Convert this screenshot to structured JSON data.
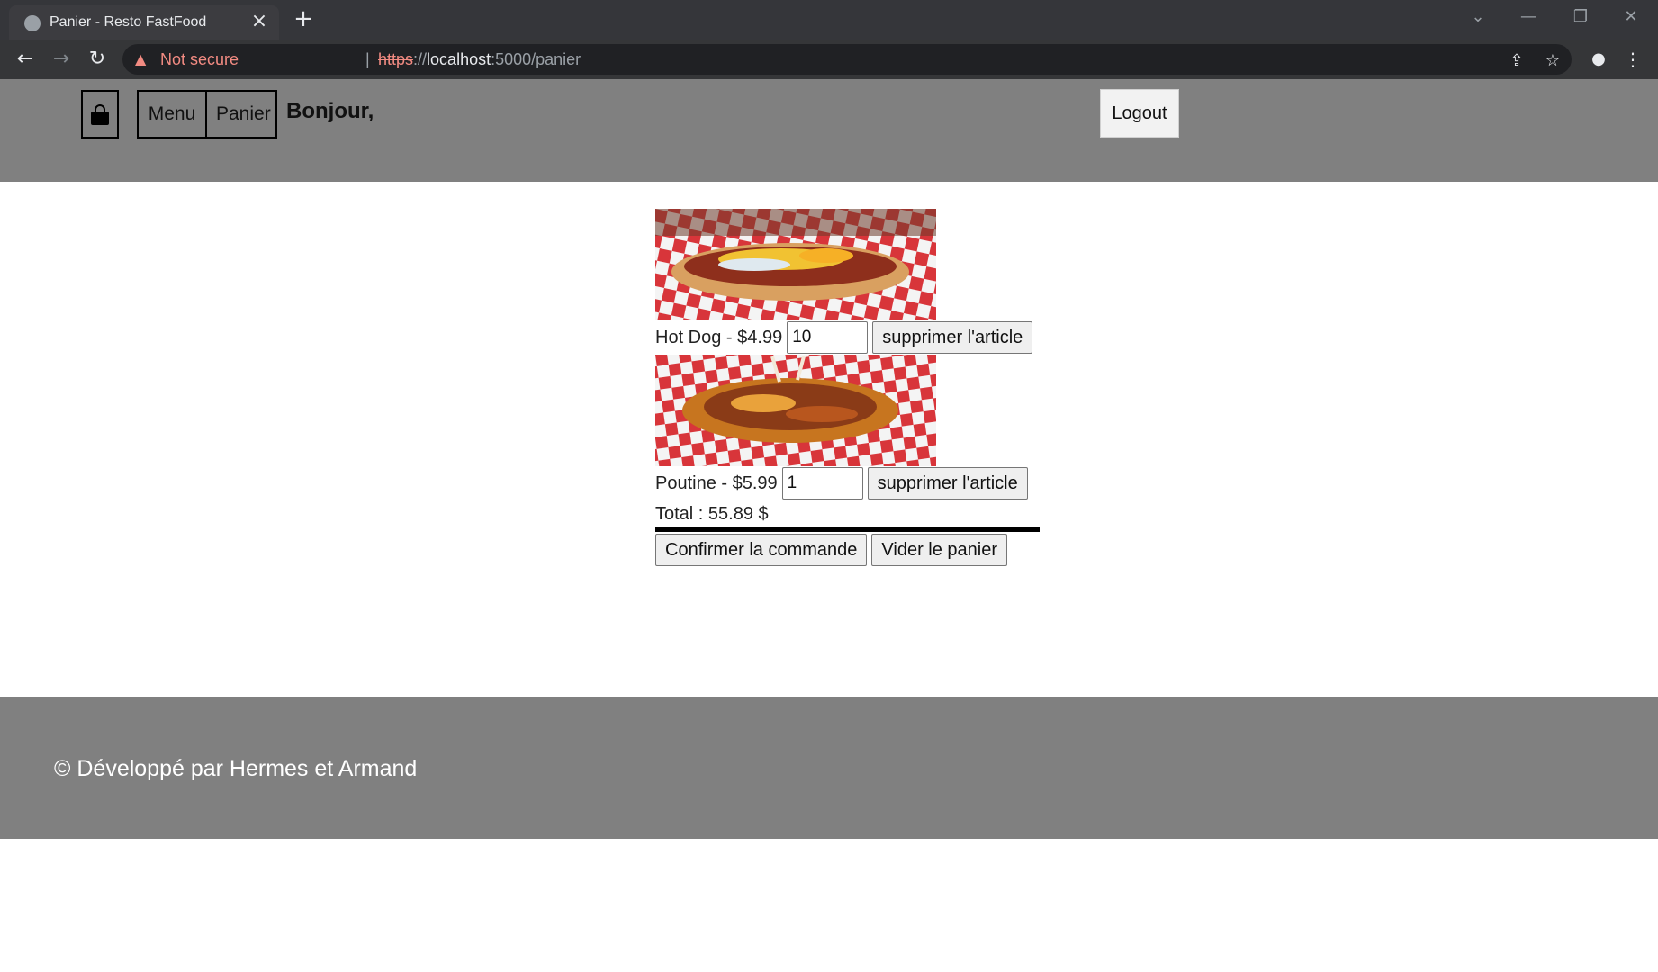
{
  "browser": {
    "tab_title": "Panier - Resto FastFood",
    "tab_close": "×",
    "new_tab": "+",
    "security_label": "Not secure",
    "url_scheme": "https",
    "url_sep": "://",
    "url_host": "localhost",
    "url_rest": ":5000/panier",
    "separator": "|"
  },
  "header": {
    "nav": [
      {
        "label": "Menu"
      },
      {
        "label": "Panier"
      }
    ],
    "greeting": "Bonjour,",
    "logout_label": "Logout"
  },
  "cart": {
    "items": [
      {
        "label": "Hot Dog - $4.99",
        "quantity": "10",
        "remove_label": "supprimer l'article",
        "image_icon": "hot-dog-image"
      },
      {
        "label": "Poutine - $5.99",
        "quantity": "1",
        "remove_label": "supprimer l'article",
        "image_icon": "poutine-image"
      }
    ],
    "total": "Total : 55.89 $",
    "confirm_label": "Confirmer la commande",
    "clear_label": "Vider le panier"
  },
  "footer": {
    "copyright": "© Développé par Hermes et Armand"
  },
  "colors": {
    "header_bg": "#808080",
    "footer_bg": "#808080",
    "checker_red": "#e03c3c"
  }
}
